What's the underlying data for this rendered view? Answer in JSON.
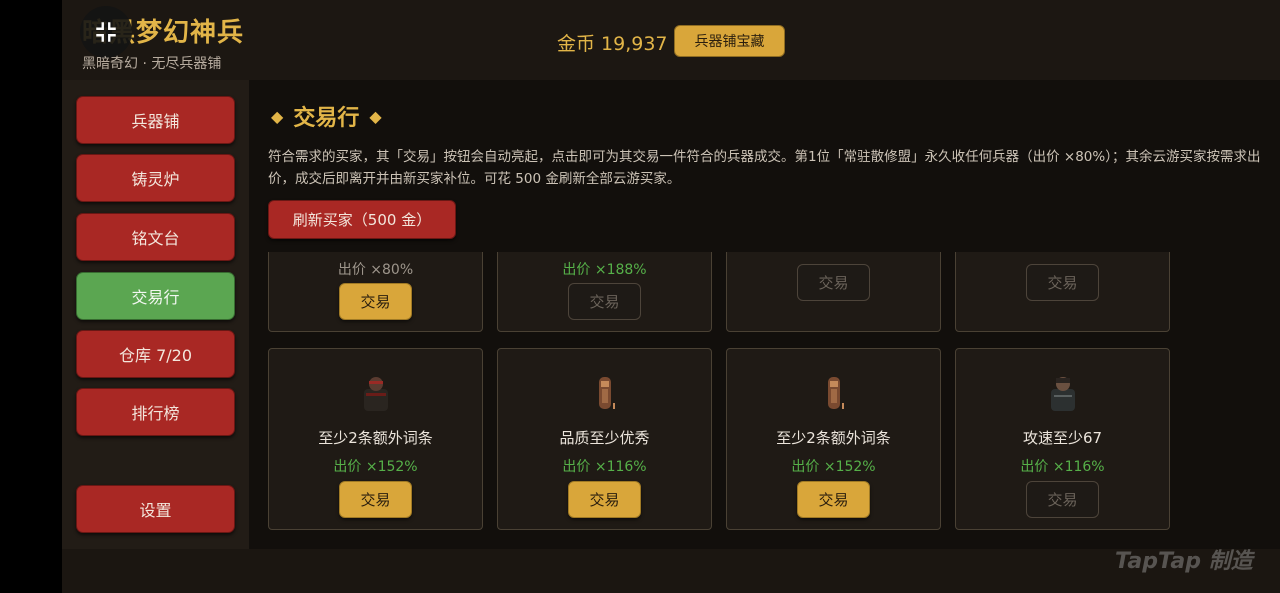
{
  "header": {
    "title": "暗黑梦幻神兵",
    "subtitle": "黑暗奇幻 · 无尽兵器铺",
    "gold_label": "金币 19,937",
    "treasure_button": "兵器铺宝藏"
  },
  "sidebar": {
    "items": [
      {
        "label": "兵器铺",
        "active": false
      },
      {
        "label": "铸灵炉",
        "active": false
      },
      {
        "label": "铭文台",
        "active": false
      },
      {
        "label": "交易行",
        "active": true
      },
      {
        "label": "仓库 7/20",
        "active": false
      },
      {
        "label": "排行榜",
        "active": false
      }
    ],
    "settings": "设置"
  },
  "main": {
    "title": "交易行",
    "diamond": "◆",
    "description": "符合需求的买家，其「交易」按钮会自动亮起，点击即可为其交易一件符合的兵器成交。第1位「常驻散修盟」永久收任何兵器（出价 ×80%）；其余云游买家按需求出价，成交后即离开并由新买家补位。可花 500 金刷新全部云游买家。",
    "refresh_button": "刷新买家（500 金）",
    "trade_label": "交易",
    "top_row": [
      {
        "price": "出价 ×80%",
        "price_color": "gray",
        "trade_enabled": true
      },
      {
        "price": "出价 ×188%",
        "price_color": "green",
        "trade_enabled": false
      },
      {
        "price": "",
        "price_color": "gray",
        "trade_enabled": false
      },
      {
        "price": "",
        "price_color": "gray",
        "trade_enabled": false
      }
    ],
    "bottom_row": [
      {
        "avatar": "armored-warrior-icon",
        "requirement": "至少2条额外词条",
        "price": "出价 ×152%",
        "trade_enabled": true
      },
      {
        "avatar": "hooded-figure-icon",
        "requirement": "品质至少优秀",
        "price": "出价 ×116%",
        "trade_enabled": true
      },
      {
        "avatar": "hooded-figure-icon",
        "requirement": "至少2条额外词条",
        "price": "出价 ×152%",
        "trade_enabled": true
      },
      {
        "avatar": "dark-knight-icon",
        "requirement": "攻速至少67",
        "price": "出价 ×116%",
        "trade_enabled": false
      }
    ]
  },
  "watermark": "TapTap 制造",
  "colors": {
    "accent_gold": "#e2b548",
    "button_red": "#a92824",
    "active_green": "#5ba651",
    "price_green": "#56b049"
  }
}
